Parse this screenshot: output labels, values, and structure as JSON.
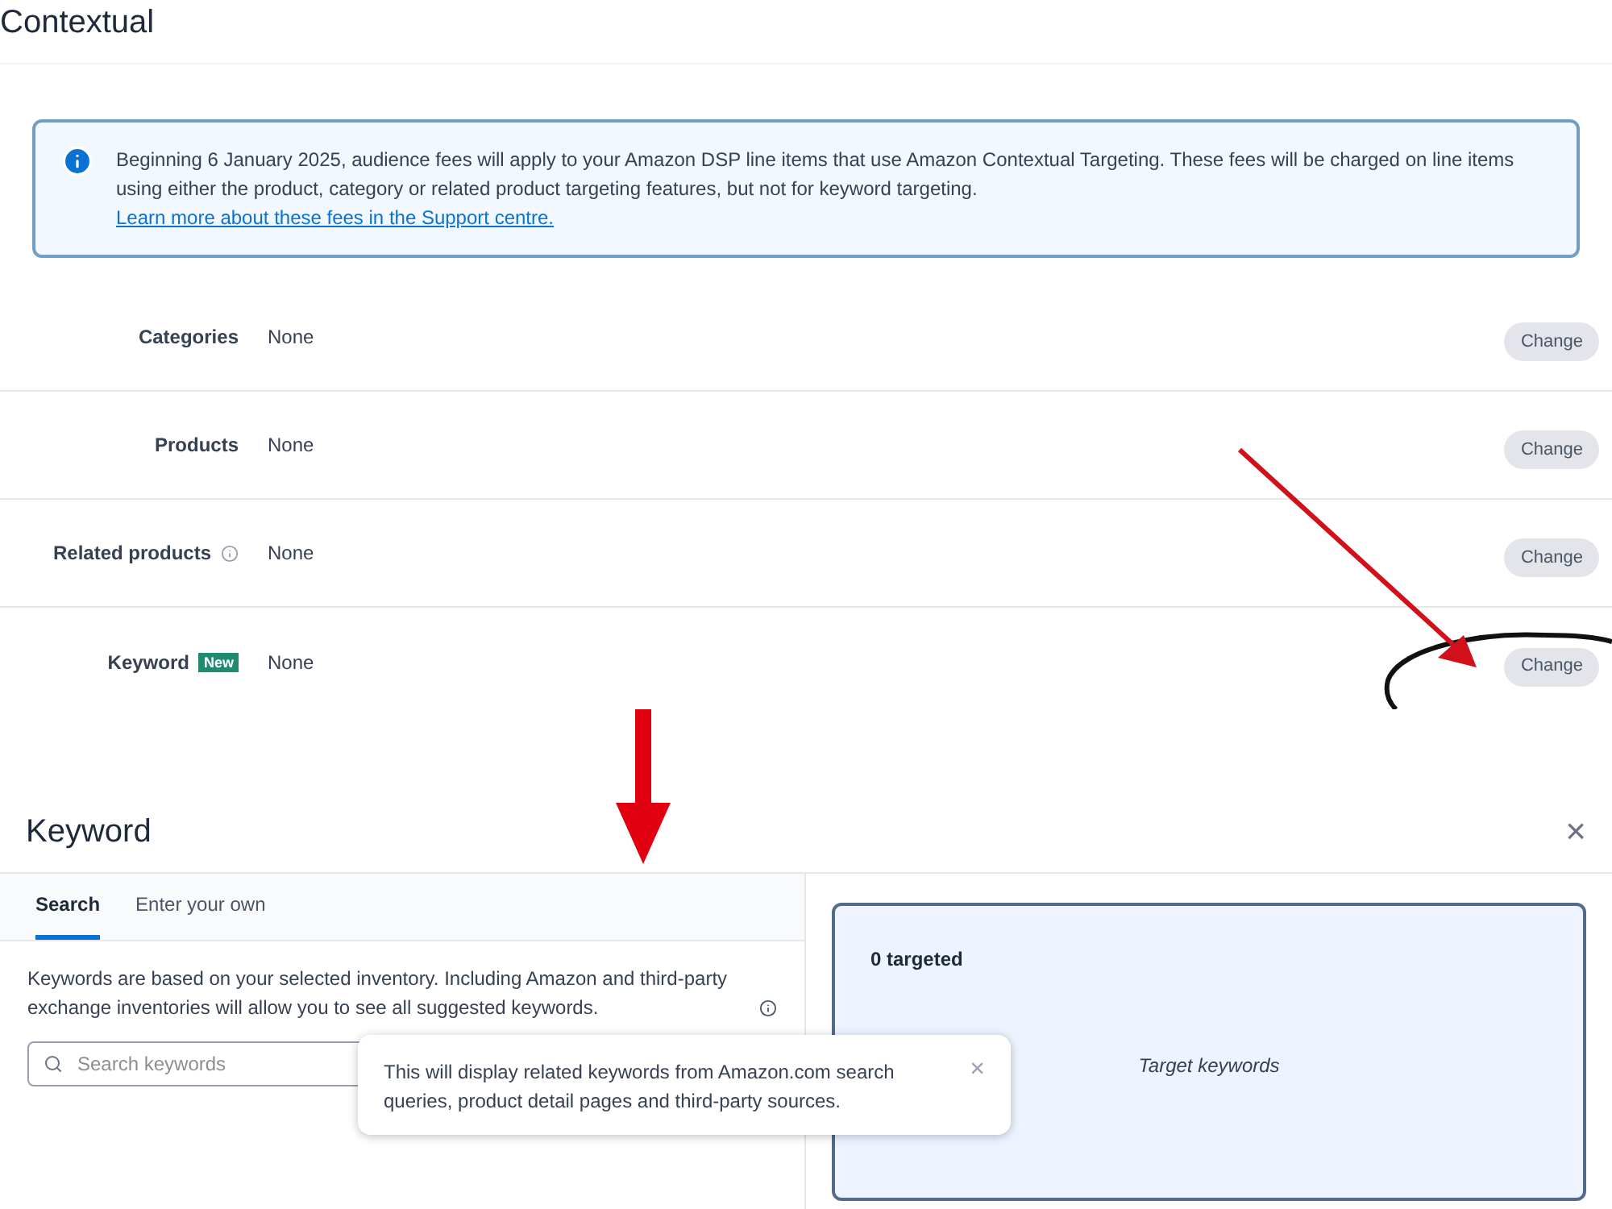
{
  "page": {
    "title": "Contextual"
  },
  "notice": {
    "text": "Beginning 6 January 2025, audience fees will apply to your Amazon DSP line items that use Amazon Contextual Targeting. These fees will be charged on line items using either the product, category or related product targeting features, but not for keyword targeting.",
    "link": "Learn more about these fees in the Support centre."
  },
  "rows": [
    {
      "label": "Categories",
      "info": false,
      "value": "None",
      "button": "Change"
    },
    {
      "label": "Products",
      "info": false,
      "value": "None",
      "button": "Change"
    },
    {
      "label": "Related products",
      "info": true,
      "value": "None",
      "button": "Change"
    },
    {
      "label": "Keyword",
      "info": false,
      "badge": "New",
      "value": "None",
      "button": "Change"
    }
  ],
  "keyword_panel": {
    "title": "Keyword",
    "close": "×",
    "tabs": [
      {
        "label": "Search",
        "selected": true
      },
      {
        "label": "Enter your own",
        "selected": false
      }
    ],
    "description": "Keywords are based on your selected inventory. Including Amazon and third-party exchange inventories will allow you to see all suggested keywords.",
    "search": {
      "placeholder": "Search keywords"
    },
    "tooltip": {
      "text": "This will display related keywords from Amazon.com search queries, product detail pages and third-party sources.",
      "close": "×"
    },
    "targeted": "0 targeted",
    "empty_state": "Target keywords"
  }
}
